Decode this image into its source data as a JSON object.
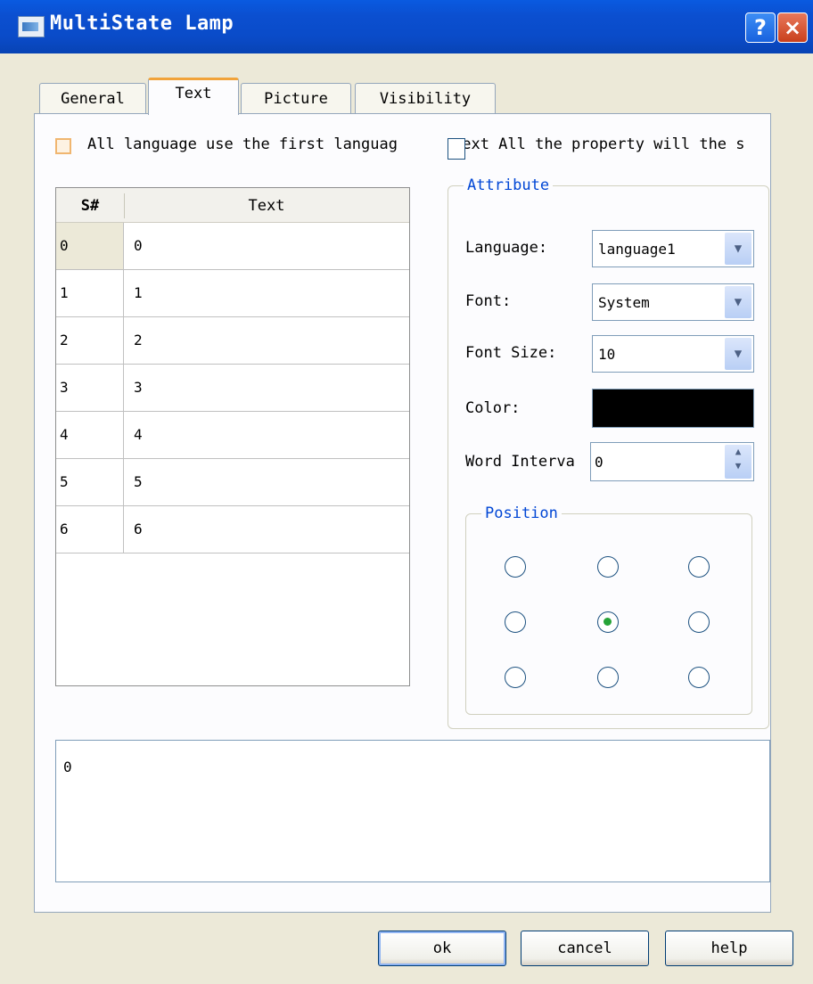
{
  "window": {
    "title": "MultiState Lamp",
    "help_label": "?",
    "close_label": "×"
  },
  "tabs": [
    {
      "label": "General"
    },
    {
      "label": "Text"
    },
    {
      "label": "Picture"
    },
    {
      "label": "Visibility"
    }
  ],
  "options": {
    "first_language_label": "All language use the first languag",
    "all_property_label": "text All the property will the s"
  },
  "grid": {
    "col_sn": "S#",
    "col_text": "Text",
    "rows": [
      {
        "sn": "0",
        "text": "0"
      },
      {
        "sn": "1",
        "text": "1"
      },
      {
        "sn": "2",
        "text": "2"
      },
      {
        "sn": "3",
        "text": "3"
      },
      {
        "sn": "4",
        "text": "4"
      },
      {
        "sn": "5",
        "text": "5"
      },
      {
        "sn": "6",
        "text": "6"
      }
    ]
  },
  "attribute": {
    "title": "Attribute",
    "language_label": "Language:",
    "language_value": "language1",
    "font_label": "Font:",
    "font_value": "System",
    "font_size_label": "Font Size:",
    "font_size_value": "10",
    "color_label": "Color:",
    "color_value": "#000000",
    "word_interval_label": "Word Interva",
    "word_interval_value": "0"
  },
  "position": {
    "title": "Position",
    "selected": "middle-center"
  },
  "text_area": {
    "value": "0"
  },
  "buttons": {
    "ok": "ok",
    "cancel": "cancel",
    "help": "help"
  },
  "icons": {
    "app": "monitor-icon",
    "dropdown": "chevron-down-icon",
    "spin": "spin-arrows-icon"
  }
}
